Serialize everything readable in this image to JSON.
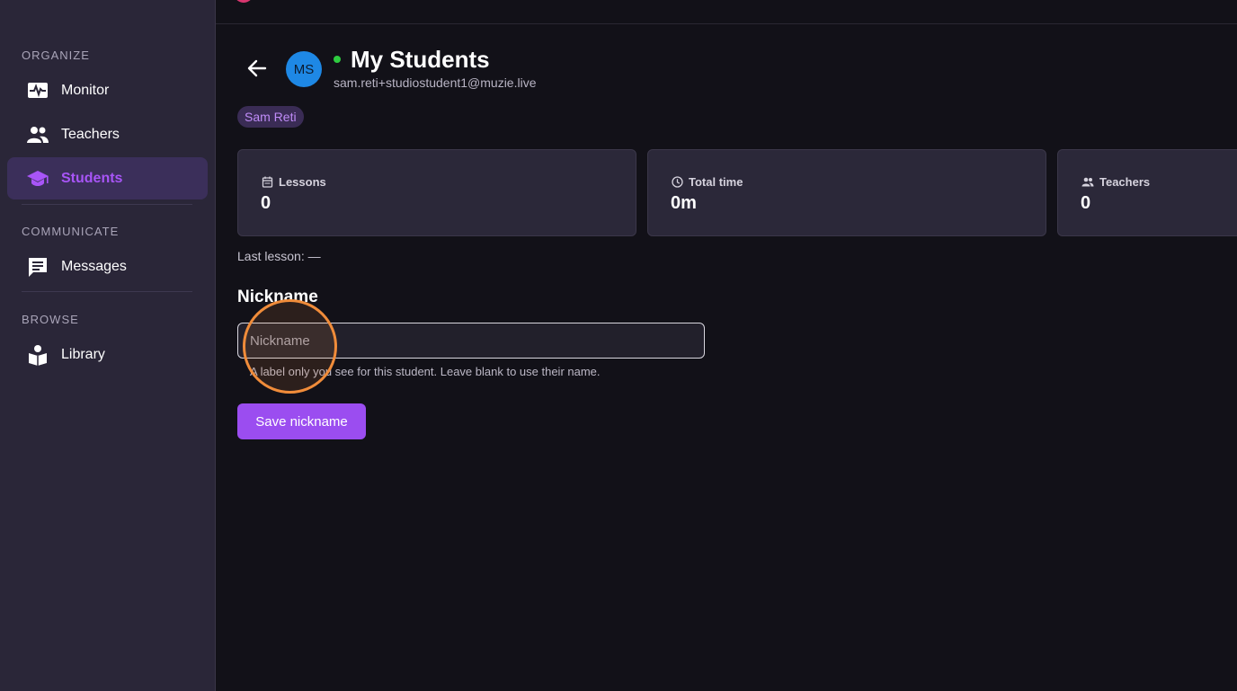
{
  "sidebar": {
    "sections": [
      {
        "title": "ORGANIZE"
      },
      {
        "title": "COMMUNICATE"
      },
      {
        "title": "BROWSE"
      }
    ],
    "items": [
      {
        "label": "Monitor",
        "icon": "monitor-heartbeat-icon"
      },
      {
        "label": "Teachers",
        "icon": "people-icon"
      },
      {
        "label": "Students",
        "icon": "graduation-cap-icon",
        "active": true
      },
      {
        "label": "Messages",
        "icon": "chat-icon"
      },
      {
        "label": "Library",
        "icon": "book-reader-icon"
      }
    ]
  },
  "header": {
    "avatar_initials": "MS",
    "title": "My Students",
    "email": "sam.reti+studiostudent1@muzie.live",
    "tag": "Sam Reti",
    "online": true
  },
  "stats": [
    {
      "label": "Lessons",
      "value": "0",
      "icon": "calendar-icon"
    },
    {
      "label": "Total time",
      "value": "0m",
      "icon": "clock-icon"
    },
    {
      "label": "Teachers",
      "value": "0",
      "icon": "people-icon"
    }
  ],
  "last_lesson": "Last lesson: —",
  "nickname": {
    "heading": "Nickname",
    "placeholder": "Nickname",
    "value": "",
    "helper": "A label only you see for this student. Leave blank to use their name.",
    "save_label": "Save nickname"
  },
  "colors": {
    "accent": "#a855f7",
    "button": "#9b4df0",
    "sidebar_bg": "#2a2638",
    "page_bg": "#121118",
    "online": "#2ecc40",
    "avatar": "#1e88e5"
  }
}
